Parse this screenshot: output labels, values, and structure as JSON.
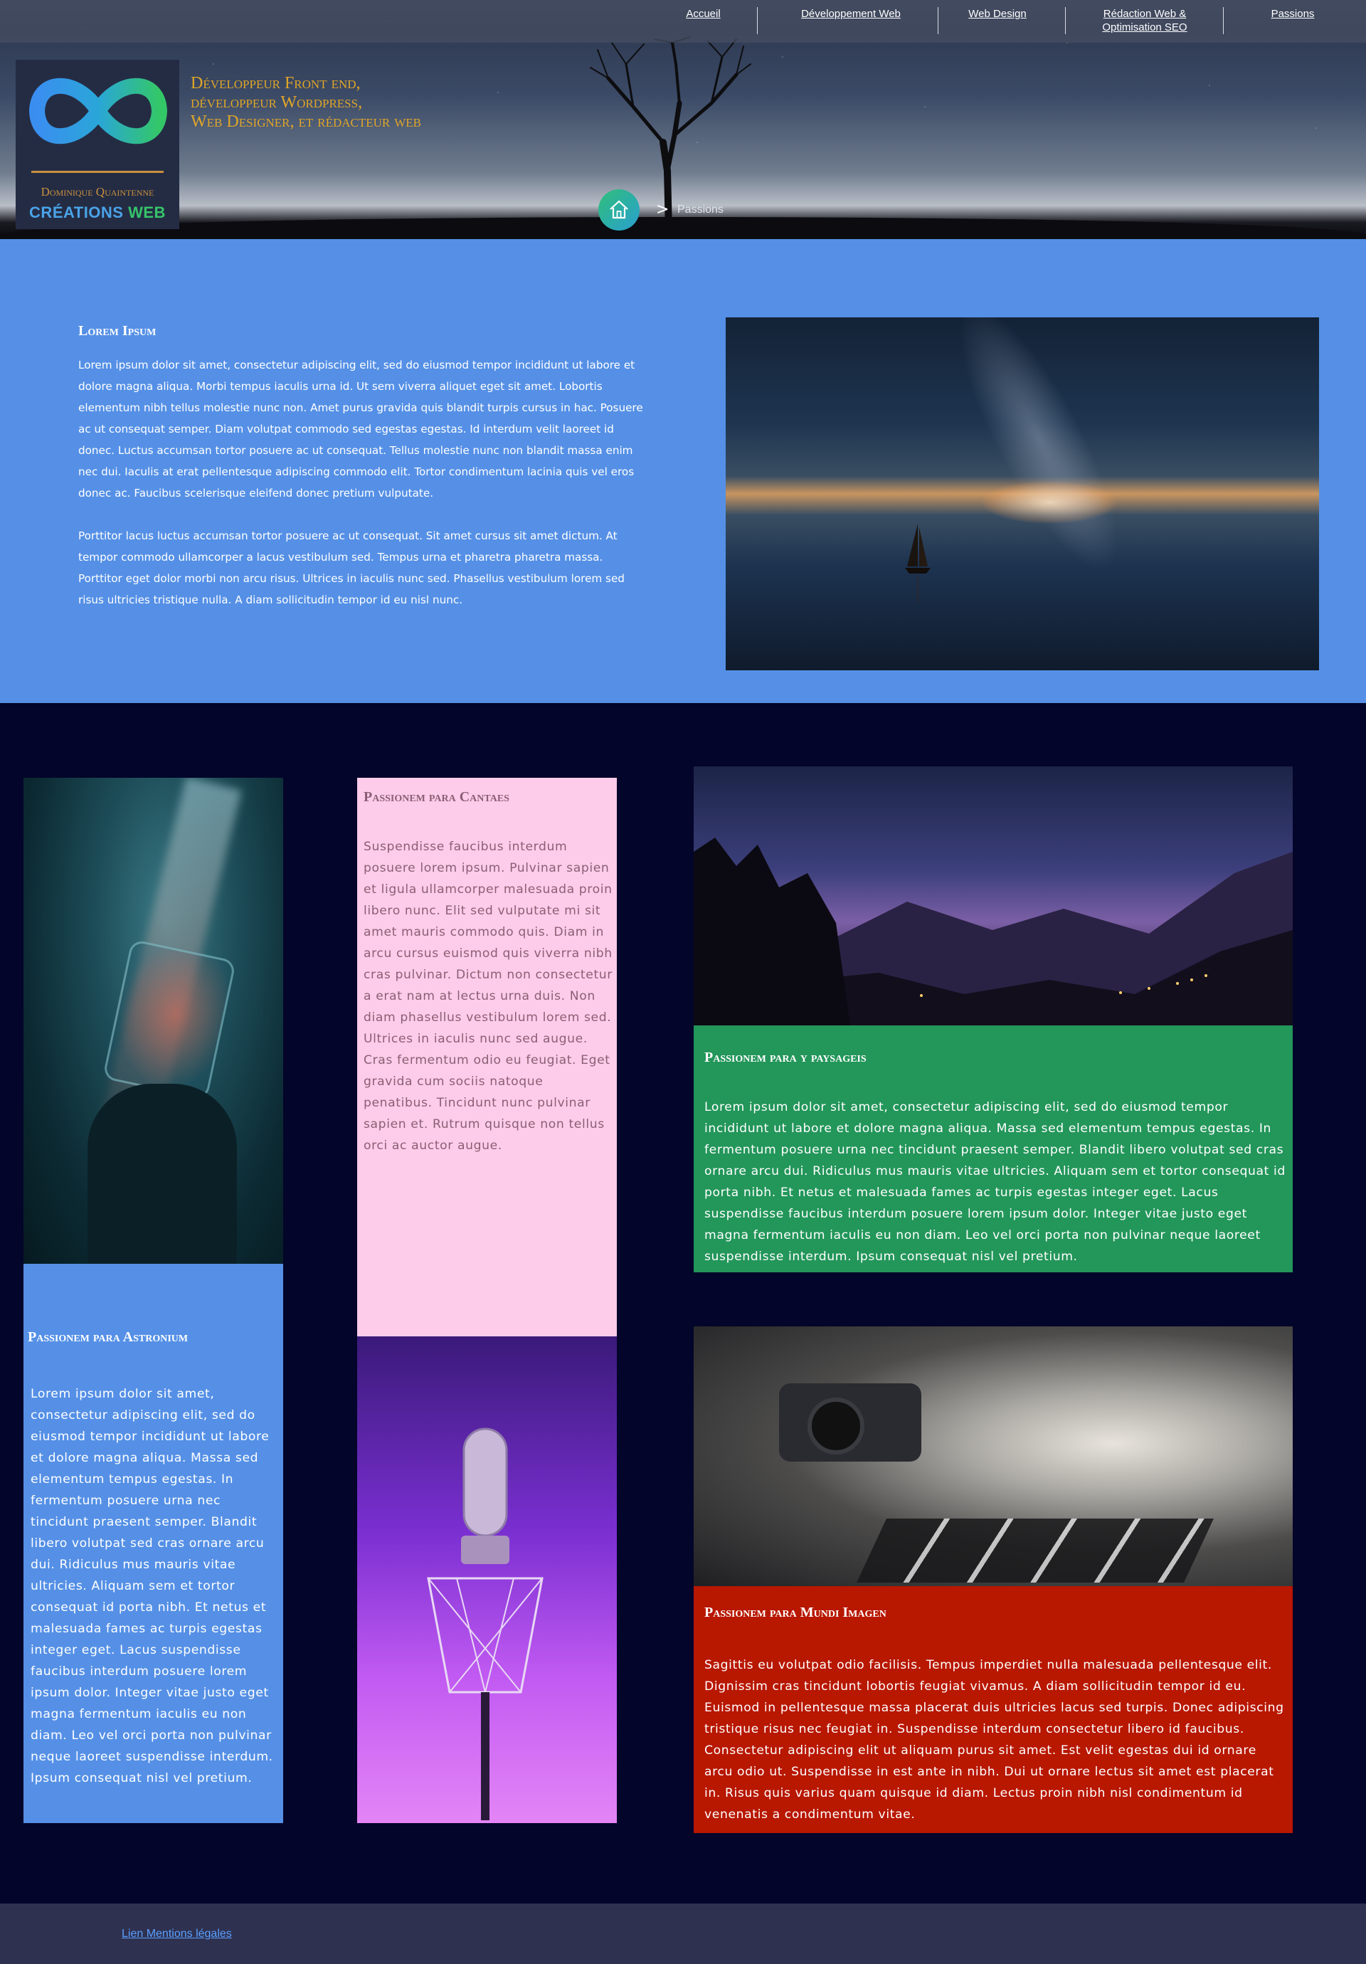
{
  "nav": {
    "items": [
      {
        "label": "Accueil"
      },
      {
        "label": "Développement Web"
      },
      {
        "label": "Web Design"
      },
      {
        "label": "Rédaction Web  &"
      },
      {
        "label": "Passions"
      }
    ],
    "seo_line2": "Optimisation SEO"
  },
  "logo": {
    "name": "Dominique Quaintenne",
    "sub_a": "CRÉATIONS",
    "sub_b": "WEB"
  },
  "tagline": {
    "line1": "Développeur Front end,",
    "line2": "développeur Wordpress,",
    "line3": "Web Designer, et rédacteur web"
  },
  "breadcrumb": {
    "separator": ">",
    "current": "Passions"
  },
  "intro": {
    "title": "Lorem Ipsum",
    "para1": "Lorem ipsum dolor sit amet, consectetur adipiscing elit, sed do eiusmod tempor incididunt ut labore et dolore magna aliqua. Morbi tempus iaculis urna id. Ut sem viverra aliquet eget sit amet. Lobortis elementum nibh tellus molestie nunc non. Amet purus gravida quis blandit turpis cursus in hac. Posuere ac ut consequat semper. Diam volutpat commodo sed egestas egestas. Id interdum velit laoreet id donec. Luctus accumsan tortor posuere ac ut consequat. Tellus molestie nunc non blandit massa enim nec dui. Iaculis at erat pellentesque adipiscing commodo elit. Tortor condimentum lacinia quis vel eros donec ac. Faucibus scelerisque eleifend donec pretium vulputate.",
    "para2": "Porttitor lacus luctus accumsan tortor posuere ac ut consequat. Sit amet cursus sit amet dictum. At tempor commodo ullamcorper a lacus vestibulum sed. Tempus urna et pharetra pharetra massa. Porttitor eget dolor morbi non arcu risus. Ultrices in iaculis nunc sed. Phasellus vestibulum lorem sed risus ultricies tristique nulla. A diam sollicitudin tempor id eu nisl nunc."
  },
  "cards": {
    "astronium": {
      "title": "Passionem para Astronium",
      "text": "Lorem ipsum dolor sit amet, consectetur adipiscing elit, sed do eiusmod tempor incididunt ut labore et dolore magna aliqua. Massa sed elementum tempus egestas. In fermentum posuere urna nec tincidunt praesent semper. Blandit libero volutpat sed cras ornare arcu dui. Ridiculus mus mauris vitae ultricies. Aliquam sem et tortor consequat id porta nibh. Et netus et malesuada fames ac turpis egestas integer eget. Lacus suspendisse faucibus interdum posuere lorem ipsum dolor. Integer vitae justo eget magna fermentum iaculis eu non diam. Leo vel orci porta non pulvinar neque laoreet suspendisse interdum. Ipsum consequat nisl vel pretium."
    },
    "cantaes": {
      "title": "Passionem para Cantaes",
      "text": "Suspendisse faucibus interdum posuere lorem ipsum. Pulvinar sapien et ligula ullamcorper malesuada proin libero nunc. Elit sed vulputate mi sit amet mauris commodo quis. Diam in arcu cursus euismod quis viverra nibh cras pulvinar. Dictum non consectetur a erat nam at lectus urna duis. Non diam phasellus vestibulum lorem sed. Ultrices in iaculis nunc sed augue. Cras fermentum odio eu feugiat. Eget gravida cum sociis natoque penatibus. Tincidunt nunc pulvinar sapien et. Rutrum quisque non tellus orci ac auctor augue."
    },
    "paysageis": {
      "title": "Passionem para y paysageis",
      "text": "Lorem ipsum dolor sit amet, consectetur adipiscing elit, sed do eiusmod tempor incididunt ut labore et dolore magna aliqua. Massa sed elementum tempus egestas. In fermentum posuere urna nec tincidunt praesent semper. Blandit libero volutpat sed cras ornare arcu dui. Ridiculus mus mauris vitae ultricies. Aliquam sem et tortor consequat id porta nibh. Et netus et malesuada fames ac turpis egestas integer eget. Lacus suspendisse faucibus interdum posuere lorem ipsum dolor. Integer vitae justo eget magna fermentum iaculis eu non diam. Leo vel orci porta non pulvinar neque laoreet suspendisse interdum. Ipsum consequat nisl vel pretium."
    },
    "mundi": {
      "title": "Passionem para Mundi Imagen",
      "text": "Sagittis eu volutpat odio facilisis. Tempus imperdiet nulla malesuada pellentesque elit. Dignissim cras tincidunt lobortis feugiat vivamus. A diam sollicitudin tempor id eu. Euismod in pellentesque massa placerat duis ultricies lacus sed turpis. Donec adipiscing tristique risus nec feugiat in. Suspendisse interdum consectetur libero id faucibus. Consectetur adipiscing elit ut aliquam purus sit amet. Est velit egestas dui id ornare arcu odio ut. Suspendisse in est ante in nibh. Dui ut ornare lectus sit amet est placerat in. Risus quis varius quam quisque id diam. Lectus proin nibh nisl condimentum id venenatis a condimentum vitae."
    }
  },
  "footer": {
    "link": "Lien Mentions légales"
  },
  "colors": {
    "intro_bg": "#5590e6",
    "body_bg": "#04052a",
    "cantaes_bg": "#fdccea",
    "paysageis_bg": "#23965a",
    "mundi_bg": "#b81700",
    "tagline": "#e0a628"
  },
  "icons": [
    "home-icon",
    "infinity-logo-icon"
  ]
}
